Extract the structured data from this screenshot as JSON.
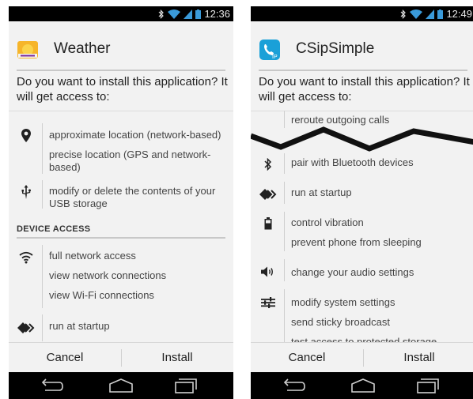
{
  "phones": [
    {
      "status": {
        "time": "12:36"
      },
      "app": {
        "name": "Weather",
        "icon": "yahoo-weather-icon"
      },
      "question": "Do you want to install this application? It will get access to:",
      "groups": [
        {
          "icon": "location-pin-icon",
          "items": [
            "approximate location (network-based)",
            "precise location (GPS and network-based)"
          ]
        },
        {
          "icon": "usb-icon",
          "items": [
            "modify or delete the contents of your USB storage"
          ]
        }
      ],
      "section_title": "DEVICE ACCESS",
      "device_groups": [
        {
          "icon": "wifi-icon",
          "items": [
            "full network access",
            "view network connections",
            "view Wi-Fi connections"
          ]
        },
        {
          "icon": "startup-arrows-icon",
          "items": [
            "run at startup"
          ]
        }
      ],
      "buttons": {
        "cancel": "Cancel",
        "install": "Install"
      }
    },
    {
      "status": {
        "time": "12:49"
      },
      "app": {
        "name": "CSipSimple",
        "icon": "csipsimple-icon"
      },
      "question": "Do you want to install this application? It will get access to:",
      "top_item": "reroute outgoing calls",
      "groups": [
        {
          "icon": "bluetooth-icon",
          "items": [
            "pair with Bluetooth devices"
          ]
        },
        {
          "icon": "startup-arrows-icon",
          "items": [
            "run at startup"
          ]
        },
        {
          "icon": "battery-icon",
          "items": [
            "control vibration",
            "prevent phone from sleeping"
          ]
        },
        {
          "icon": "speaker-icon",
          "items": [
            "change your audio settings"
          ]
        },
        {
          "icon": "settings-sliders-icon",
          "items": [
            "modify system settings",
            "send sticky broadcast",
            "test access to protected storage"
          ]
        }
      ],
      "buttons": {
        "cancel": "Cancel",
        "install": "Install"
      }
    }
  ]
}
